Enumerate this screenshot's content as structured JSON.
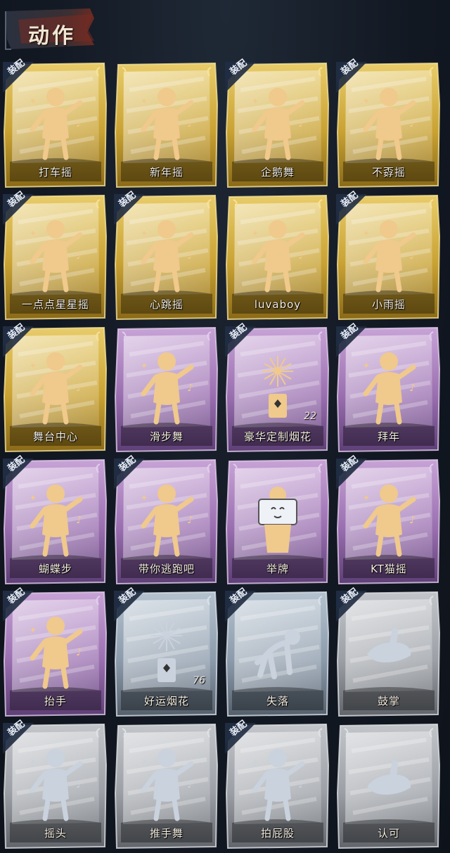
{
  "header": {
    "title": "动作"
  },
  "badge_label": "装配",
  "colors": {
    "gold": "#c9a233",
    "purple": "#9a6fb0",
    "blue_grey": "#8c9bab",
    "grey": "#9ca0a6",
    "figure_gold": "#f0c98c",
    "figure_silver": "#c9d2dd"
  },
  "actions": [
    {
      "label": "打车摇",
      "tier": "gold",
      "equipped": true,
      "icon": "dancer-hand-on-chest-icon"
    },
    {
      "label": "新年摇",
      "tier": "gold",
      "equipped": false,
      "icon": "dancer-arms-crossed-icon"
    },
    {
      "label": "企鹅舞",
      "tier": "gold",
      "equipped": true,
      "icon": "penguin-dance-icon"
    },
    {
      "label": "不孬摇",
      "tier": "gold",
      "equipped": true,
      "icon": "dancer-arm-raised-icon"
    },
    {
      "label": "一点点星星摇",
      "tier": "gold",
      "equipped": true,
      "icon": "star-dance-icon"
    },
    {
      "label": "心跳摇",
      "tier": "gold",
      "equipped": true,
      "icon": "heartbeat-dance-icon"
    },
    {
      "label": "luvaboy",
      "tier": "gold",
      "equipped": false,
      "icon": "luvaboy-dance-icon"
    },
    {
      "label": "小雨摇",
      "tier": "gold",
      "equipped": true,
      "icon": "rain-dance-icon"
    },
    {
      "label": "舞台中心",
      "tier": "gold",
      "equipped": true,
      "icon": "center-stage-icon"
    },
    {
      "label": "滑步舞",
      "tier": "purple",
      "equipped": false,
      "icon": "slide-step-icon"
    },
    {
      "label": "豪华定制烟花",
      "tier": "purple",
      "equipped": true,
      "icon": "deluxe-fireworks-icon",
      "count": "22"
    },
    {
      "label": "拜年",
      "tier": "purple",
      "equipped": true,
      "icon": "new-year-greeting-icon"
    },
    {
      "label": "蝴蝶步",
      "tier": "purple",
      "equipped": true,
      "icon": "butterfly-step-icon"
    },
    {
      "label": "带你逃跑吧",
      "tier": "purple",
      "equipped": true,
      "icon": "run-away-dance-icon"
    },
    {
      "label": "举牌",
      "tier": "purple",
      "equipped": false,
      "icon": "hold-sign-icon"
    },
    {
      "label": "KT猫摇",
      "tier": "purple",
      "equipped": true,
      "icon": "kitty-dance-icon"
    },
    {
      "label": "抬手",
      "tier": "purple",
      "equipped": true,
      "icon": "raise-hand-icon"
    },
    {
      "label": "好运烟花",
      "tier": "blue",
      "equipped": true,
      "icon": "lucky-fireworks-icon",
      "count": "76"
    },
    {
      "label": "失落",
      "tier": "blue",
      "equipped": true,
      "icon": "crawling-figure-icon"
    },
    {
      "label": "鼓掌",
      "tier": "grey",
      "equipped": true,
      "icon": "clapping-hands-icon"
    },
    {
      "label": "摇头",
      "tier": "grey",
      "equipped": true,
      "icon": "head-shake-icon"
    },
    {
      "label": "推手舞",
      "tier": "grey",
      "equipped": false,
      "icon": "push-hands-dance-icon"
    },
    {
      "label": "拍屁股",
      "tier": "grey",
      "equipped": true,
      "icon": "butt-slap-icon"
    },
    {
      "label": "认可",
      "tier": "grey",
      "equipped": false,
      "icon": "thumbs-up-icon"
    }
  ]
}
